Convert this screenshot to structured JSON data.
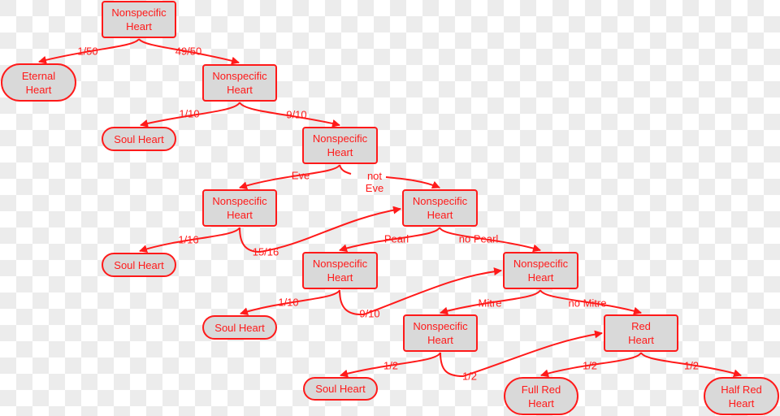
{
  "diagram": {
    "nodes": [
      {
        "id": "n1",
        "label": "Nonspecific\nHeart",
        "shape": "rect"
      },
      {
        "id": "eternal",
        "label": "Eternal\nHeart",
        "shape": "pill"
      },
      {
        "id": "n2",
        "label": "Nonspecific\nHeart",
        "shape": "rect"
      },
      {
        "id": "soul1",
        "label": "Soul Heart",
        "shape": "pill"
      },
      {
        "id": "n3",
        "label": "Nonspecific\nHeart",
        "shape": "rect"
      },
      {
        "id": "n4",
        "label": "Nonspecific\nHeart",
        "shape": "rect"
      },
      {
        "id": "n5",
        "label": "Nonspecific\nHeart",
        "shape": "rect"
      },
      {
        "id": "soul2",
        "label": "Soul Heart",
        "shape": "pill"
      },
      {
        "id": "n6",
        "label": "Nonspecific\nHeart",
        "shape": "rect"
      },
      {
        "id": "n7",
        "label": "Nonspecific\nHeart",
        "shape": "rect"
      },
      {
        "id": "soul3",
        "label": "Soul Heart",
        "shape": "pill"
      },
      {
        "id": "n8",
        "label": "Nonspecific\nHeart",
        "shape": "rect"
      },
      {
        "id": "red",
        "label": "Red\nHeart",
        "shape": "rect"
      },
      {
        "id": "soul4",
        "label": "Soul Heart",
        "shape": "pill"
      },
      {
        "id": "fullred",
        "label": "Full Red\nHeart",
        "shape": "pill"
      },
      {
        "id": "halfred",
        "label": "Half Red\nHeart",
        "shape": "pill"
      }
    ],
    "edges": [
      {
        "from": "n1",
        "to": "eternal",
        "label": "1/50"
      },
      {
        "from": "n1",
        "to": "n2",
        "label": "49/50"
      },
      {
        "from": "n2",
        "to": "soul1",
        "label": "1/10"
      },
      {
        "from": "n2",
        "to": "n3",
        "label": "9/10"
      },
      {
        "from": "n3",
        "to": "n4",
        "label": "Eve"
      },
      {
        "from": "n3",
        "to": "n5",
        "label": "not\nEve"
      },
      {
        "from": "n4",
        "to": "soul2",
        "label": "1/16"
      },
      {
        "from": "n4",
        "to": "n5",
        "label": "15/16"
      },
      {
        "from": "n5",
        "to": "n6",
        "label": "Pearl"
      },
      {
        "from": "n5",
        "to": "n7",
        "label": "no Pearl"
      },
      {
        "from": "n6",
        "to": "soul3",
        "label": "1/10"
      },
      {
        "from": "n6",
        "to": "n7",
        "label": "9/10"
      },
      {
        "from": "n7",
        "to": "n8",
        "label": "Mitre"
      },
      {
        "from": "n7",
        "to": "red",
        "label": "no Mitre"
      },
      {
        "from": "n8",
        "to": "soul4",
        "label": "1/2"
      },
      {
        "from": "n8",
        "to": "red",
        "label": "1/2"
      },
      {
        "from": "red",
        "to": "fullred",
        "label": "1/2"
      },
      {
        "from": "red",
        "to": "halfred",
        "label": "1/2"
      }
    ],
    "colors": {
      "stroke": "#ff1a1a",
      "node_fill": "#d9d9d9",
      "text": "#ff1a1a"
    }
  }
}
